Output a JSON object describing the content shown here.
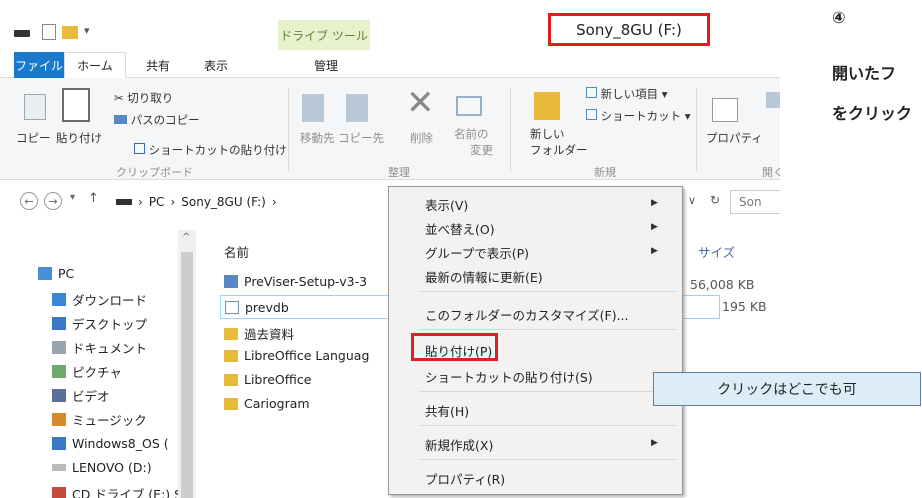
{
  "window": {
    "title": "Sony_8GU (F:)",
    "contextual_tab": "ドライブ ツール"
  },
  "tabs": {
    "file": "ファイル",
    "home": "ホーム",
    "share": "共有",
    "view": "表示",
    "manage": "管理"
  },
  "ribbon": {
    "copy": "コピー",
    "paste": "貼り付け",
    "cut": "切り取り",
    "copy_path": "パスのコピー",
    "paste_shortcut": "ショートカットの貼り付け",
    "group_clipboard": "クリップボード",
    "move_to": "移動先",
    "copy_to": "コピー先",
    "delete": "削除",
    "rename_l1": "名前の",
    "rename_l2": "変更",
    "group_organize": "整理",
    "new_folder_l1": "新しい",
    "new_folder_l2": "フォルダー",
    "new_item": "新しい項目 ▾",
    "shortcut": "ショートカット ▾",
    "group_new": "新規",
    "properties": "プロパティ",
    "group_open": "開く"
  },
  "address": {
    "pc": "PC",
    "drive": "Sony_8GU (F:)",
    "search": "Son"
  },
  "columns": {
    "name": "名前",
    "size": "サイズ"
  },
  "nav": {
    "items": [
      "PC",
      "ダウンロード",
      "デスクトップ",
      "ドキュメント",
      "ピクチャ",
      "ビデオ",
      "ミュージック",
      "Windows8_OS (",
      "LENOVO (D:)",
      "CD ドライブ (E:) S"
    ]
  },
  "files": [
    {
      "name": "PreViser-Setup-v3-3",
      "size": "56,008 KB"
    },
    {
      "name": "prevdb",
      "size": "195 KB"
    },
    {
      "name": "過去資料",
      "size": ""
    },
    {
      "name": "LibreOffice Languag",
      "size": ""
    },
    {
      "name": "LibreOffice",
      "size": ""
    },
    {
      "name": "Cariogram",
      "size": ""
    }
  ],
  "context_menu": {
    "view": "表示(V)",
    "sort": "並べ替え(O)",
    "group": "グループで表示(P)",
    "refresh": "最新の情報に更新(E)",
    "customize": "このフォルダーのカスタマイズ(F)...",
    "paste": "貼り付け(P)",
    "paste_shortcut": "ショートカットの貼り付け(S)",
    "share": "共有(H)",
    "new": "新規作成(X)",
    "properties": "プロパティ(R)"
  },
  "annotation": {
    "callout": "クリックはどこでも可",
    "step": "④",
    "line1": "開いたフ",
    "line2": "をクリック"
  },
  "colors": {
    "accent": "#1979ca",
    "highlight": "#e21d1d",
    "callout_bg": "#dcedf8"
  }
}
